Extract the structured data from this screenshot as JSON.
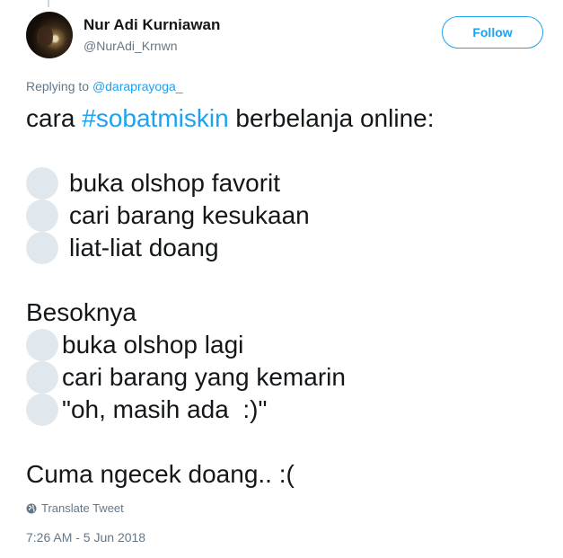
{
  "user": {
    "name": "Nur Adi Kurniawan",
    "handle": "@NurAdi_Krnwn"
  },
  "follow_button": "Follow",
  "reply": {
    "prefix": "Replying to ",
    "to": "@daraprayoga_"
  },
  "tweet": {
    "intro_before": "cara ",
    "hashtag": "#sobatmiskin",
    "intro_after": " berbelanja online:",
    "list1": [
      "buka olshop favorit",
      "cari barang kesukaan",
      "liat-liat doang"
    ],
    "besok": "Besoknya",
    "list2": [
      "buka olshop lagi",
      "cari barang yang kemarin",
      "\"oh, masih ada  :)\""
    ],
    "closing": "Cuma ngecek doang.. :("
  },
  "translate_label": "Translate Tweet",
  "timestamp": "7:26 AM - 5 Jun 2018",
  "colors": {
    "accent": "#1da1f2",
    "text": "#14171a",
    "muted": "#657786",
    "emoji_placeholder": "#e1e8ed"
  },
  "icons": {
    "translate": "globe-icon"
  }
}
